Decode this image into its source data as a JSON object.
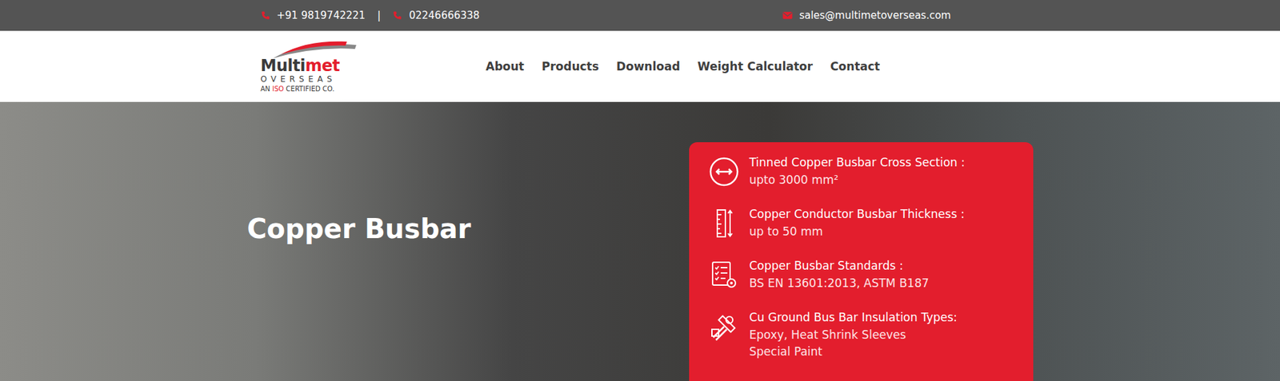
{
  "top_bar": {
    "phones": [
      "+91 9819742221",
      "02246666338"
    ],
    "separator": "|",
    "email": "sales@multimetoverseas.com"
  },
  "logo": {
    "name_part1": "Multi",
    "name_part2": "met",
    "sub": "OVERSEAS",
    "tagline_pre": "AN ",
    "tagline_iso": "ISO",
    "tagline_post": " CERTIFIED CO."
  },
  "nav": [
    "About",
    "Products",
    "Download",
    "Weight Calculator",
    "Contact"
  ],
  "hero": {
    "title": "Copper Busbar"
  },
  "specs": [
    {
      "kind": "cross-section",
      "label": "Tinned Copper Busbar Cross Section :",
      "values": [
        "upto 3000 mm²"
      ]
    },
    {
      "kind": "thickness",
      "label": "Copper Conductor Busbar Thickness :",
      "values": [
        "up to 50 mm"
      ]
    },
    {
      "kind": "standards",
      "label": "Copper Busbar Standards :",
      "values": [
        "BS EN 13601:2013, ASTM B187"
      ]
    },
    {
      "kind": "insulation",
      "label": "Cu Ground Bus Bar Insulation Types:",
      "values": [
        "Epoxy, Heat Shrink Sleeves",
        "Special Paint"
      ]
    }
  ]
}
